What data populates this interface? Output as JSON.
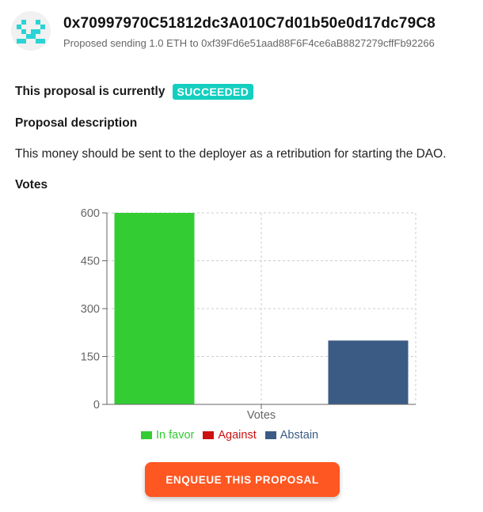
{
  "header": {
    "address": "0x70997970C51812dc3A010C7d01b50e0d17dc79C8",
    "subtitle": "Proposed sending 1.0 ETH to 0xf39Fd6e51aad88F6F4ce6aB8827279cffFb92266",
    "avatar_color": "#2ad4d4"
  },
  "status": {
    "prefix": "This proposal is currently",
    "badge": "SUCCEEDED",
    "badge_color": "#14cfc0"
  },
  "description": {
    "heading": "Proposal description",
    "text": "This money should be sent to the deployer as a retribution for starting the DAO."
  },
  "votes": {
    "heading": "Votes"
  },
  "chart_data": {
    "type": "bar",
    "categories": [
      "Votes"
    ],
    "series": [
      {
        "name": "In favor",
        "values": [
          600
        ],
        "color": "#33cc33"
      },
      {
        "name": "Against",
        "values": [
          0
        ],
        "color": "#cc1111"
      },
      {
        "name": "Abstain",
        "values": [
          200
        ],
        "color": "#3b5b85"
      }
    ],
    "yticks": [
      "0",
      "150",
      "300",
      "450",
      "600"
    ],
    "ylim": [
      0,
      600
    ],
    "grid": true,
    "legend_position": "bottom"
  },
  "actions": {
    "enqueue_label": "ENQUEUE THIS PROPOSAL",
    "enqueue_color": "#ff5722"
  }
}
